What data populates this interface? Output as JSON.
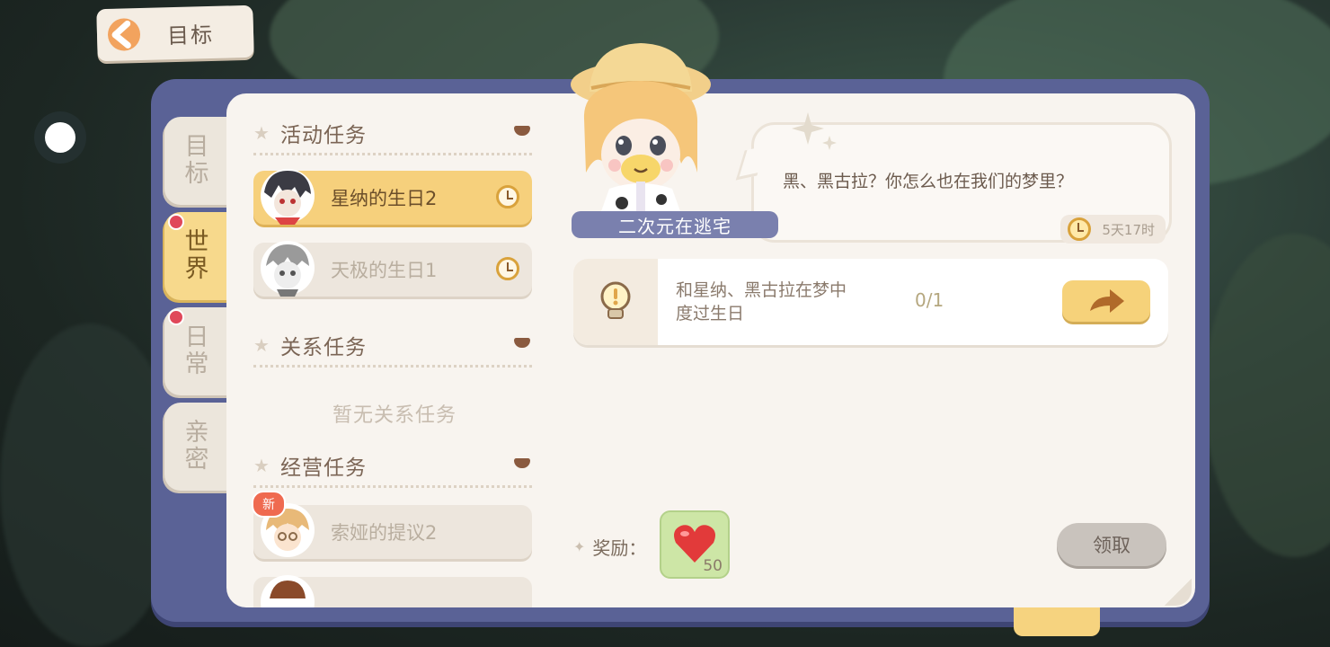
{
  "header": {
    "back_label": "目标"
  },
  "side_tabs": [
    {
      "label": "目\n标",
      "active": false,
      "dot": false
    },
    {
      "label": "世\n界",
      "active": true,
      "dot": true
    },
    {
      "label": "日\n常",
      "active": false,
      "dot": true
    },
    {
      "label": "亲\n密",
      "active": false,
      "dot": false
    }
  ],
  "sections": {
    "activity": {
      "title": "活动任务"
    },
    "relation": {
      "title": "关系任务",
      "empty": "暂无关系任务"
    },
    "business": {
      "title": "经营任务"
    }
  },
  "tasks": {
    "activity": [
      {
        "label": "星纳的生日2",
        "active": true
      },
      {
        "label": "天极的生日1",
        "active": false
      }
    ],
    "business": [
      {
        "label": "索娅的提议2",
        "badge": "新"
      }
    ]
  },
  "dialog": {
    "speaker": "二次元在逃宅",
    "text": "黑、黑古拉？你怎么也在我们的梦里？",
    "time_left": "5天17时"
  },
  "objective": {
    "description": "和星纳、黑古拉在梦中度过生日",
    "progress": "0/1"
  },
  "reward": {
    "label": "奖励：",
    "item_icon": "heart-icon",
    "item_count": "50",
    "claim_label": "领取"
  },
  "colors": {
    "frame": "#5a6296",
    "panel": "#f8f4ef",
    "accent_yellow": "#f6d07c",
    "name_tag": "#7a80ae"
  }
}
